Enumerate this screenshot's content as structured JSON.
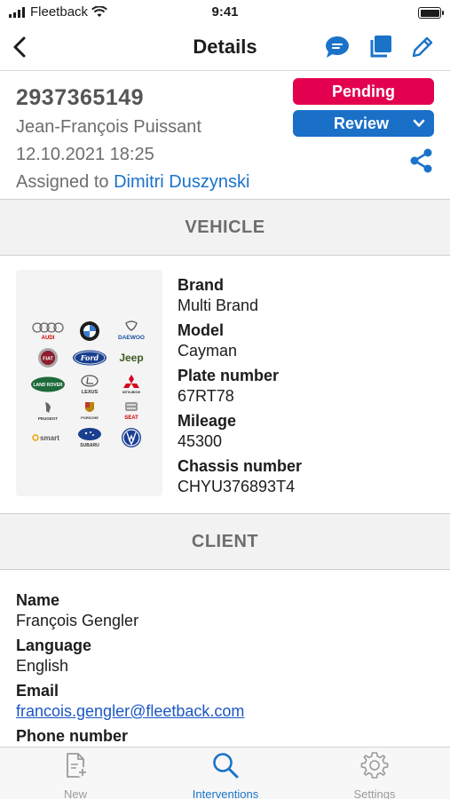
{
  "status_bar": {
    "carrier": "Fleetback",
    "time": "9:41"
  },
  "nav": {
    "title": "Details"
  },
  "order": {
    "number": "2937365149",
    "customer": "Jean-François Puissant",
    "date": "12.10.2021 18:25",
    "assigned_prefix": "Assigned to",
    "assigned_name": "Dimitri Duszynski",
    "status": "Pending",
    "action": "Review"
  },
  "colors": {
    "pending": "#e3004f",
    "review": "#1a6fc7",
    "accent": "#1a73c9"
  },
  "sections": {
    "vehicle": "VEHICLE",
    "client": "CLIENT"
  },
  "vehicle": {
    "brand_label": "Brand",
    "brand": "Multi Brand",
    "model_label": "Model",
    "model": "Cayman",
    "plate_label": "Plate number",
    "plate": "67RT78",
    "mileage_label": "Mileage",
    "mileage": "45300",
    "chassis_label": "Chassis number",
    "chassis": "CHYU376893T4",
    "logos": [
      "AUDI",
      "BMW",
      "DAEWOO",
      "FIAT",
      "Ford",
      "Jeep",
      "LAND ROVER",
      "LEXUS",
      "MITSUBISHI",
      "PEUGEOT",
      "PORSCHE",
      "SEAT",
      "smart",
      "SUBARU",
      "VW"
    ]
  },
  "client": {
    "name_label": "Name",
    "name": "François Gengler",
    "language_label": "Language",
    "language": "English",
    "email_label": "Email",
    "email": "francois.gengler@fleetback.com",
    "phone_label": "Phone number"
  },
  "tabs": [
    {
      "label": "New",
      "icon": "new-document-icon"
    },
    {
      "label": "Interventions",
      "icon": "search-icon"
    },
    {
      "label": "Settings",
      "icon": "gear-icon"
    }
  ]
}
